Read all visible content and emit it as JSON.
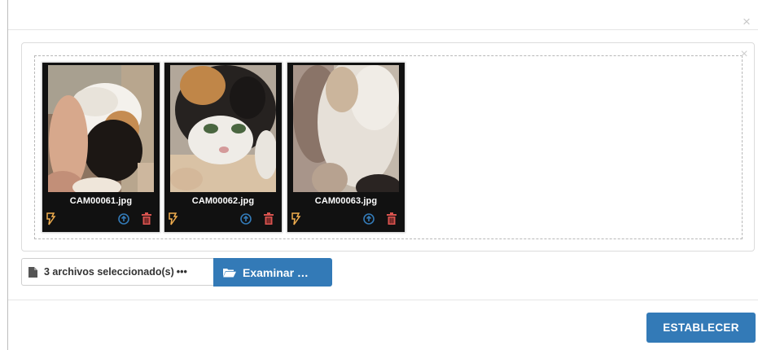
{
  "modal": {
    "close_glyph": "×"
  },
  "preview": {
    "close_glyph": "×",
    "files": [
      {
        "name": "CAM00061.jpg",
        "actions": [
          "zoom-icon",
          "upload-icon",
          "trash-icon"
        ]
      },
      {
        "name": "CAM00062.jpg",
        "actions": [
          "zoom-icon",
          "upload-icon",
          "trash-icon"
        ]
      },
      {
        "name": "CAM00063.jpg",
        "actions": [
          "zoom-icon",
          "upload-icon",
          "trash-icon"
        ]
      }
    ]
  },
  "file_input": {
    "caption": "3 archivos seleccionado(s)",
    "ellipsis": "•••",
    "browse_label": "Examinar …",
    "icon": "file-icon",
    "browse_icon": "folder-open-icon"
  },
  "footer": {
    "submit_label": "ESTABLECER"
  },
  "colors": {
    "primary": "#337ab7",
    "zoom": "#f0ad4e",
    "upload": "#337ab7",
    "delete": "#d9534f"
  }
}
